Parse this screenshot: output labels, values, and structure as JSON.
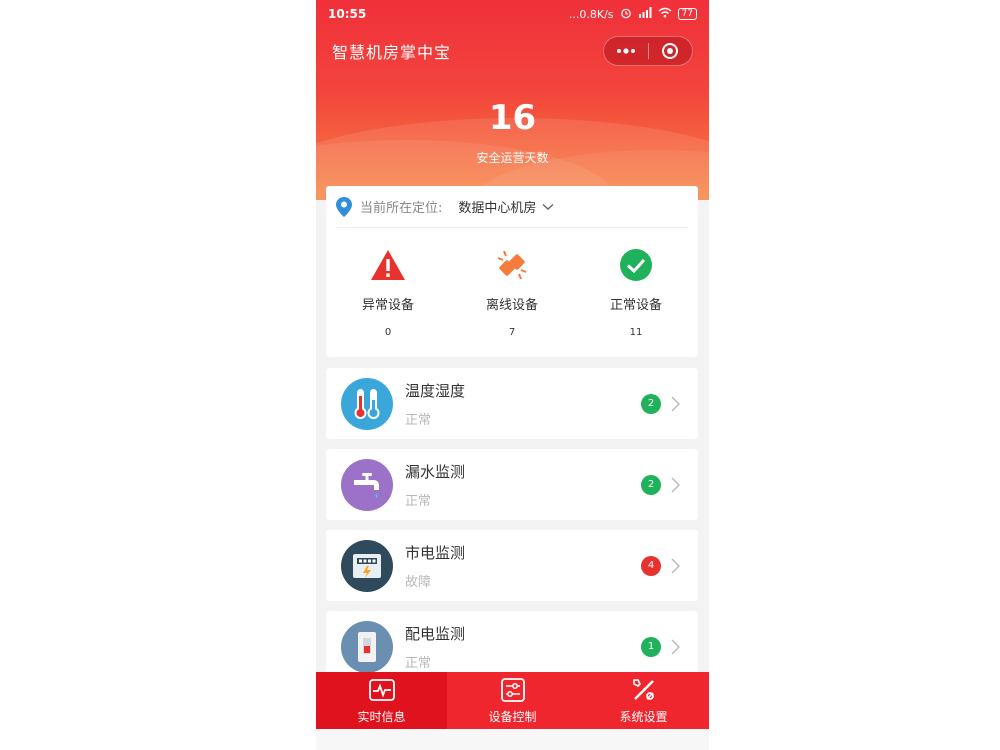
{
  "status_bar": {
    "time": "10:55",
    "network_speed": "...0.8K/s",
    "battery": "77"
  },
  "app": {
    "title": "智慧机房掌中宝"
  },
  "hero": {
    "safe_days": "16",
    "safe_days_label": "安全运营天数"
  },
  "location": {
    "label": "当前所在定位:",
    "value": "数据中心机房"
  },
  "summary": [
    {
      "label": "异常设备",
      "count": "0",
      "icon": "warning-icon",
      "color": "#e8322f"
    },
    {
      "label": "离线设备",
      "count": "7",
      "icon": "disconnect-icon",
      "color": "#f57c3a"
    },
    {
      "label": "正常设备",
      "count": "11",
      "icon": "check-icon",
      "color": "#1fb25a"
    }
  ],
  "monitors": [
    {
      "title": "温度湿度",
      "status": "正常",
      "count": "2",
      "badge_color": "#1fb25a",
      "icon": "thermometer-icon",
      "avatar_color": "#3aa6d9"
    },
    {
      "title": "漏水监测",
      "status": "正常",
      "count": "2",
      "badge_color": "#1fb25a",
      "icon": "faucet-icon",
      "avatar_color": "#9b72c8"
    },
    {
      "title": "市电监测",
      "status": "故障",
      "count": "4",
      "badge_color": "#e8322f",
      "icon": "power-meter-icon",
      "avatar_color": "#2e4a5c"
    },
    {
      "title": "配电监测",
      "status": "正常",
      "count": "1",
      "badge_color": "#1fb25a",
      "icon": "switch-icon",
      "avatar_color": "#6a8fb0"
    }
  ],
  "tabs": [
    {
      "label": "实时信息",
      "icon": "pulse-icon",
      "active": true
    },
    {
      "label": "设备控制",
      "icon": "sliders-icon",
      "active": false
    },
    {
      "label": "系统设置",
      "icon": "tools-icon",
      "active": false
    }
  ]
}
